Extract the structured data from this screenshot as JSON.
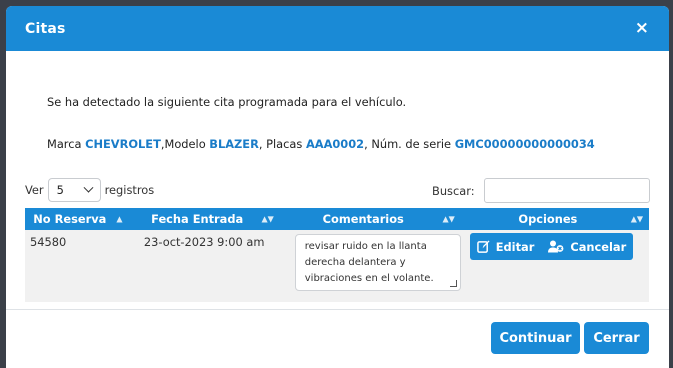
{
  "modal": {
    "title": "Citas",
    "close_symbol": "×"
  },
  "message": "Se ha detectado la siguiente cita programada para el vehículo.",
  "vehicle": {
    "marca_label": "Marca ",
    "marca": "CHEVROLET",
    "modelo_label": ",Modelo ",
    "modelo": "BLAZER",
    "placas_label": ", Placas ",
    "placas": "AAA0002",
    "serie_label": ", Núm. de serie ",
    "serie": "GMC00000000000034"
  },
  "table_controls": {
    "show_label": "Ver",
    "page_size": "5",
    "records_label": "registros",
    "search_label": "Buscar:",
    "search_value": ""
  },
  "table": {
    "columns": [
      "No Reserva",
      "Fecha Entrada",
      "Comentarios",
      "Opciones"
    ],
    "rows": [
      {
        "no_reserva": "54580",
        "fecha": "23-oct-2023 9:00 am",
        "comentario": "revisar ruido en la llanta derecha delantera y vibraciones en el volante.",
        "edit_label": "Editar",
        "cancel_label": "Cancelar"
      }
    ]
  },
  "footer": {
    "continue_label": "Continuar",
    "close_label": "Cerrar"
  },
  "colors": {
    "primary": "#1a8ad6",
    "link": "#1a7cc8",
    "backdrop": "#3b4049"
  }
}
